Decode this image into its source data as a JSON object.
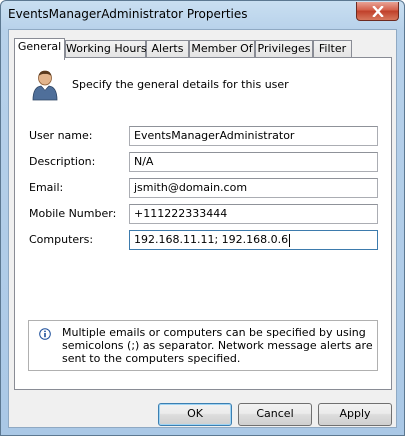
{
  "window": {
    "title": "EventsManagerAdministrator Properties"
  },
  "tabs": [
    {
      "label": "General"
    },
    {
      "label": "Working Hours"
    },
    {
      "label": "Alerts"
    },
    {
      "label": "Member Of"
    },
    {
      "label": "Privileges"
    },
    {
      "label": "Filter"
    }
  ],
  "active_tab": "General",
  "header": {
    "icon": "user-icon",
    "description": "Specify the general details for this user"
  },
  "fields": {
    "username": {
      "label": "User name:",
      "value": "EventsManagerAdministrator"
    },
    "description": {
      "label": "Description:",
      "value": "N/A"
    },
    "email": {
      "label": "Email:",
      "value": "jsmith@domain.com"
    },
    "mobile": {
      "label": "Mobile Number:",
      "value": "+111222333444"
    },
    "computers": {
      "label": "Computers:",
      "value": "192.168.11.11; 192.168.0.6"
    }
  },
  "info": {
    "icon": "info-icon",
    "text": "Multiple emails or computers can be specified by using semicolons (;) as separator. Network message alerts are sent to the computers specified."
  },
  "buttons": {
    "ok": "OK",
    "cancel": "Cancel",
    "apply": "Apply"
  },
  "colors": {
    "close_button": "#c0402a",
    "frame": "#b7d1ea",
    "focus_border": "#3d7bad"
  }
}
